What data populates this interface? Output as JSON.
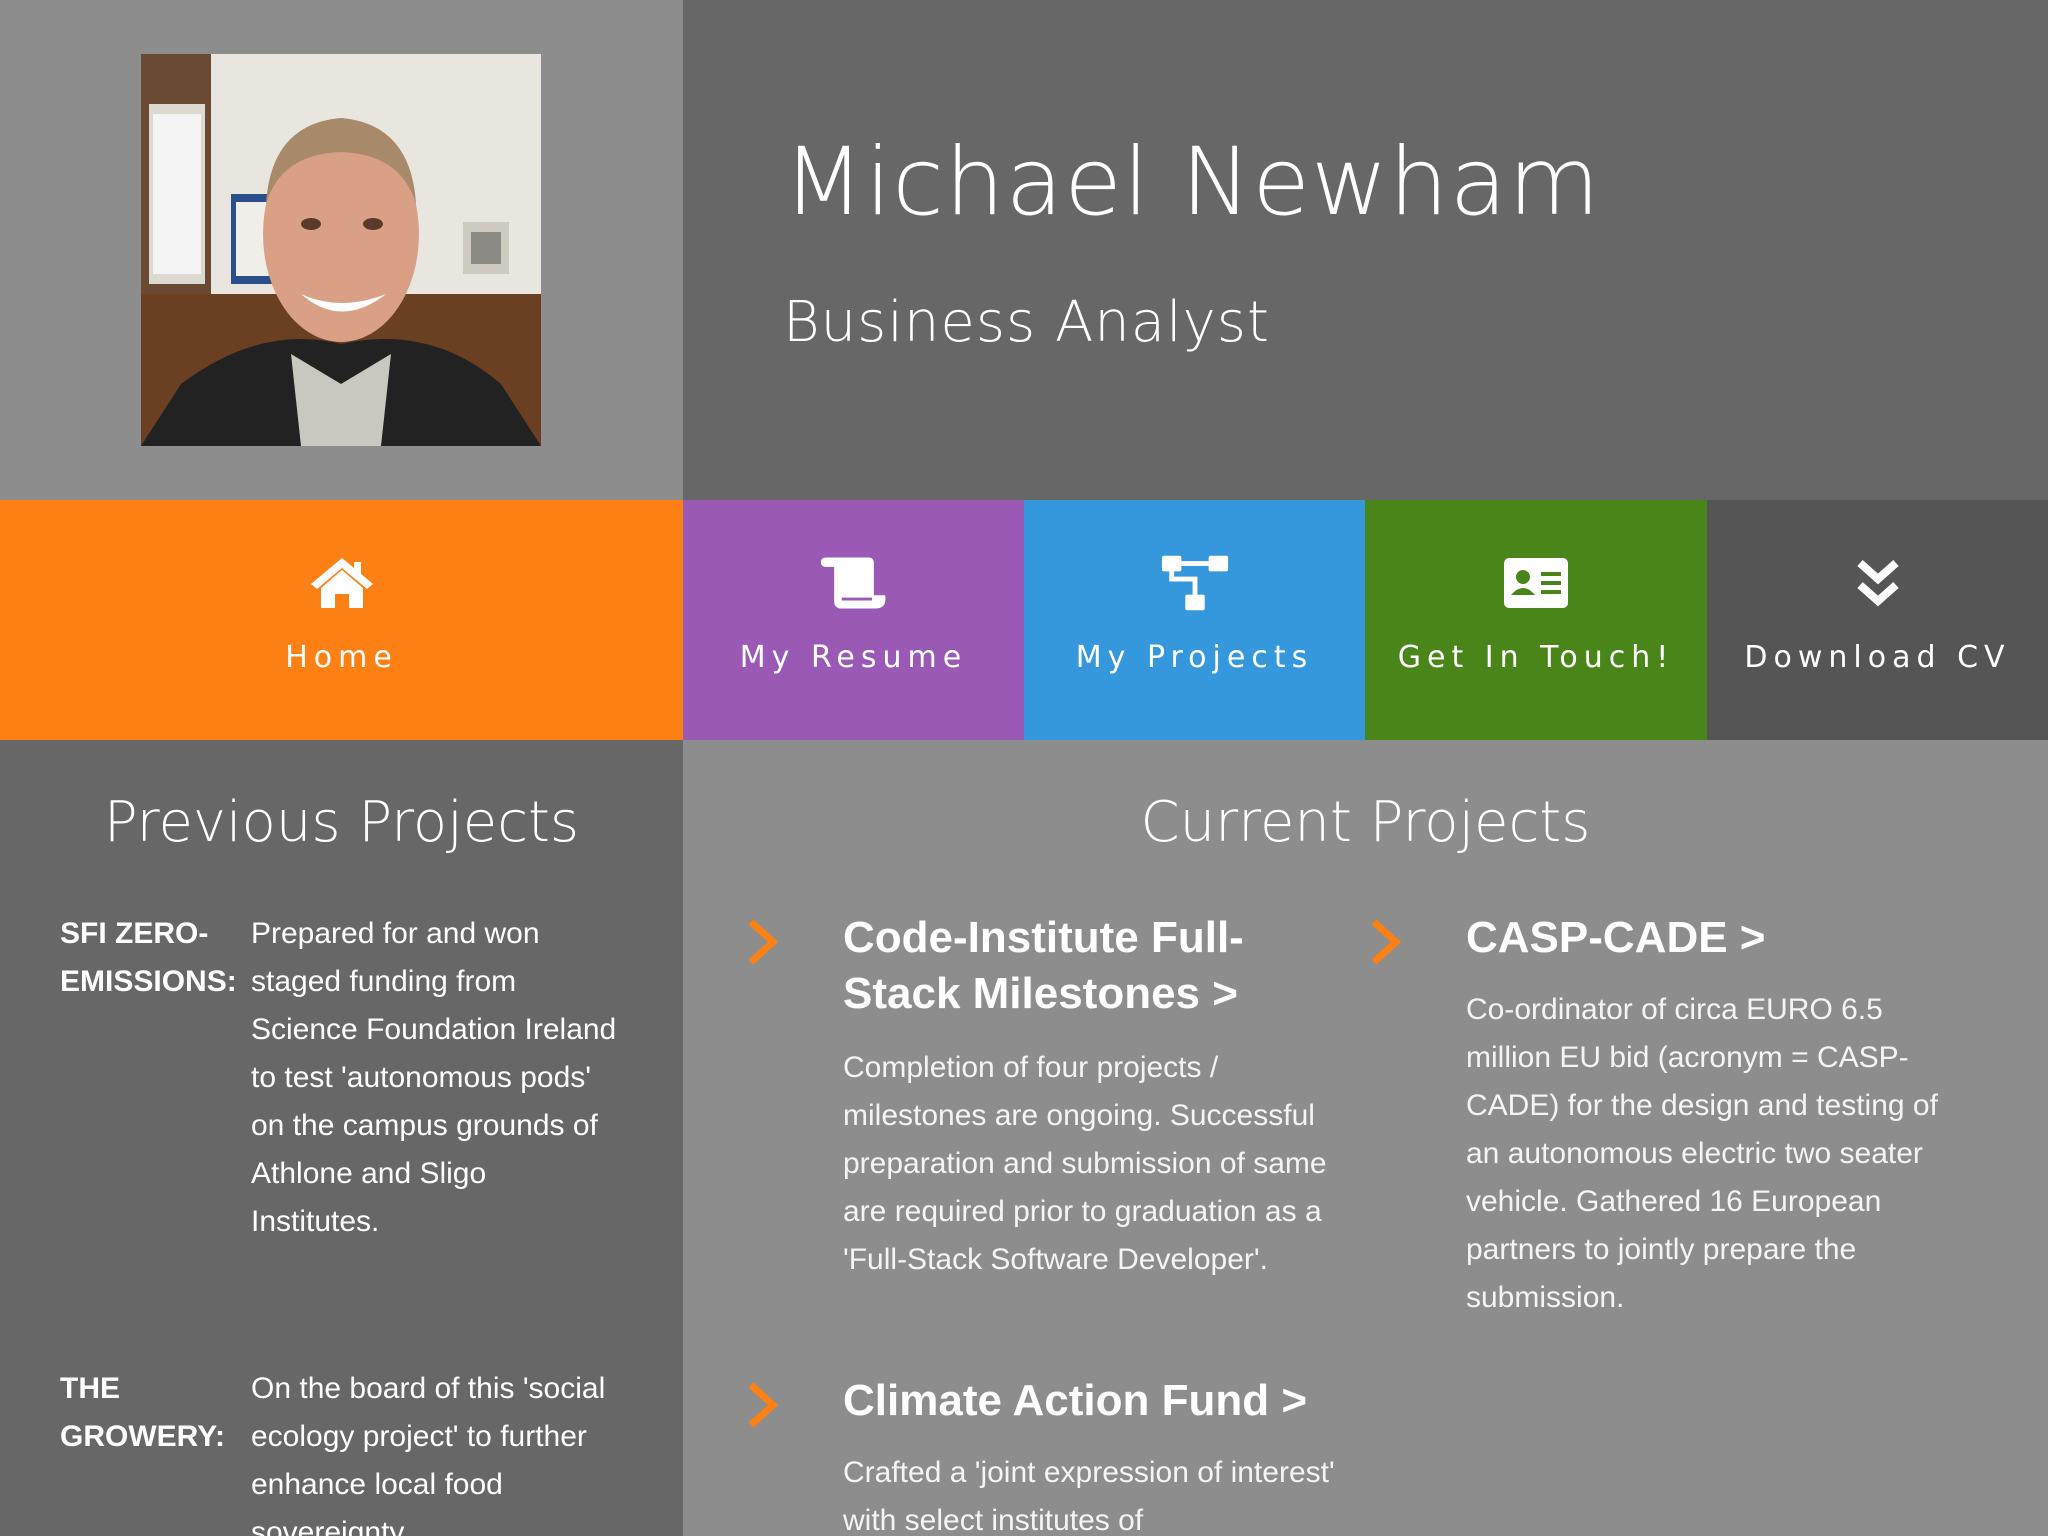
{
  "profile": {
    "name": "Michael Newham",
    "role": "Business Analyst"
  },
  "nav": [
    {
      "label": "Home",
      "icon": "home-icon",
      "color": "#fc8014"
    },
    {
      "label": "My Resume",
      "icon": "scroll-icon",
      "color": "#9a59b5"
    },
    {
      "label": "My Projects",
      "icon": "sitemap-icon",
      "color": "#3598dc"
    },
    {
      "label": "Get In Touch!",
      "icon": "contact-card-icon",
      "color": "#4a8519"
    },
    {
      "label": "Download CV",
      "icon": "double-chevron-down-icon",
      "color": "#555555"
    }
  ],
  "previous": {
    "title": "Previous Projects",
    "items": [
      {
        "term": "SFI ZERO-EMISSIONS:",
        "desc": "Prepared for and won staged funding from Science Foundation Ireland to test 'autonomous pods' on the campus grounds of Athlone and Sligo Institutes."
      },
      {
        "term": "THE GROWERY:",
        "desc": "On the board of this 'social ecology project' to further enhance local food sovereignty"
      }
    ]
  },
  "current": {
    "title": "Current Projects",
    "accent": "#fc8014",
    "projects": [
      {
        "title": "Code-Institute Full-Stack Milestones >",
        "desc": "Completion of four projects / milestones are ongoing. Successful preparation and submission of same are required prior to graduation as a 'Full-Stack Software Developer'."
      },
      {
        "title": "CASP-CADE >",
        "desc": "Co-ordinator of circa EURO 6.5 million EU bid (acronym = CASP-CADE) for the design and testing of an autonomous electric two seater vehicle. Gathered 16 European partners to jointly prepare the submission."
      },
      {
        "title": "Climate Action Fund >",
        "desc": "Crafted a 'joint expression of interest' with select institutes of"
      }
    ]
  }
}
